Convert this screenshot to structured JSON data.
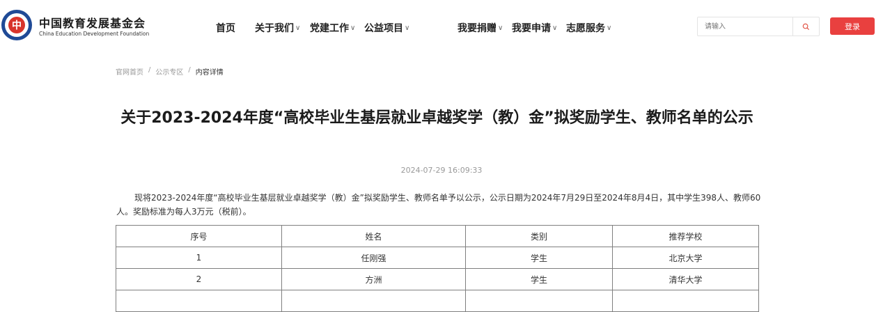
{
  "header": {
    "brand_cn": "中国教育发展基金会",
    "brand_en": "China Education Development Foundation",
    "logo_glyph": "中",
    "nav": [
      {
        "label": "首页",
        "has_dropdown": false
      },
      {
        "label": "关于我们",
        "has_dropdown": true
      },
      {
        "label": "党建工作",
        "has_dropdown": true
      },
      {
        "label": "公益项目",
        "has_dropdown": true
      },
      {
        "label": "我要捐赠",
        "has_dropdown": true
      },
      {
        "label": "我要申请",
        "has_dropdown": true
      },
      {
        "label": "志愿服务",
        "has_dropdown": true
      }
    ],
    "search_placeholder": "请输入",
    "login_label": "登录"
  },
  "breadcrumb": [
    "官网首页",
    "公示专区",
    "内容详情"
  ],
  "article": {
    "title": "关于2023-2024年度“高校毕业生基层就业卓越奖学（教）金”拟奖励学生、教师名单的公示",
    "date": "2024-07-29 16:09:33",
    "paragraph": "现将2023-2024年度“高校毕业生基层就业卓越奖学（教）金”拟奖励学生、教师名单予以公示，公示日期为2024年7月29日至2024年8月4日，其中学生398人、教师60人。奖励标准为每人3万元（税前）。"
  },
  "table": {
    "headers": [
      "序号",
      "姓名",
      "类别",
      "推荐学校"
    ],
    "rows": [
      [
        "1",
        "任刚强",
        "学生",
        "北京大学"
      ],
      [
        "2",
        "方洲",
        "学生",
        "清华大学"
      ],
      [
        "",
        "",
        "",
        ""
      ]
    ]
  },
  "colors": {
    "accent": "#e9403f",
    "brand_blue": "#1f4a96"
  }
}
